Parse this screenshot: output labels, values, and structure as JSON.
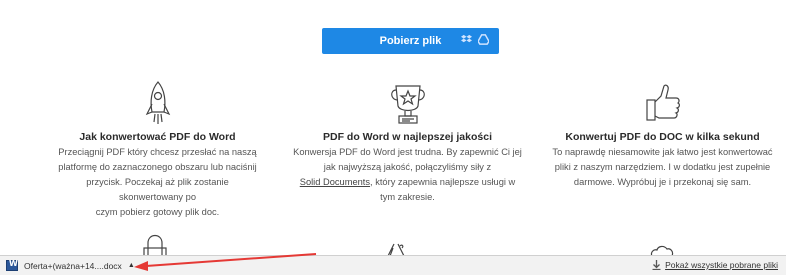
{
  "download_button": {
    "label": "Pobierz plik",
    "color": "#1e88e5"
  },
  "features": [
    {
      "icon": "rocket-icon",
      "title": "Jak konwertować PDF do Word",
      "lines": [
        "Przeciągnij PDF który chcesz przesłać na naszą",
        "platformę do zaznaczonego obszaru lub naciśnij",
        "przycisk. Poczekaj aż plik zostanie skonwertowany po",
        "czym pobierz gotowy plik doc."
      ]
    },
    {
      "icon": "trophy-icon",
      "title": "PDF do Word w najlepszej jakości",
      "lines": [
        "Konwersja PDF do Word jest trudna. By zapewnić Ci jej",
        "jak najwyższą jakość, połączyliśmy siły z"
      ],
      "link": "Solid Documents",
      "link_tail": ", który zapewnia najlepsze usługi w",
      "last_line": "tym zakresie."
    },
    {
      "icon": "thumbs-up-icon",
      "title": "Konwertuj PDF do DOC w kilka sekund",
      "lines": [
        "To naprawdę niesamowite jak łatwo jest konwertować",
        "pliki z naszym narzędziem. I w dodatku jest zupełnie",
        "darmowe. Wypróbuj je i przekonaj się sam."
      ]
    }
  ],
  "download_bar": {
    "file_name": "Oferta+(ważna+14....docx",
    "show_all": "Pokaż wszystkie pobrane pliki",
    "annotation_color": "#e53935"
  }
}
